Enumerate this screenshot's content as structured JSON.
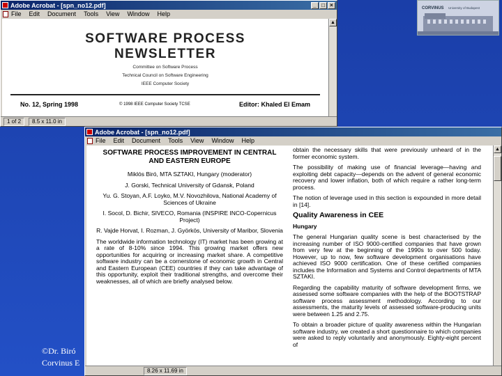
{
  "back_window": {
    "title": "Adobe Acrobat - [spn_no12.pdf]",
    "menu": [
      "File",
      "Edit",
      "Document",
      "Tools",
      "View",
      "Window",
      "Help"
    ],
    "newsletter": {
      "title_line1": "SOFTWARE PROCESS",
      "title_line2": "NEWSLETTER",
      "sub1": "Committee on Software Process",
      "sub2": "Technical Council on Software Engineering",
      "sub3": "IEEE Computer Society",
      "issue": "No. 12, Spring 1998",
      "copyright": "© 1998 IEEE Computer Society TCSE",
      "editor": "Editor: Khaled El Emam"
    },
    "status": {
      "page": "1 of 2",
      "size": "8.5 x 11.0 in"
    }
  },
  "front_window": {
    "title": "Adobe Acrobat - [spn_no12.pdf]",
    "menu": [
      "File",
      "Edit",
      "Document",
      "Tools",
      "View",
      "Window",
      "Help"
    ],
    "left": {
      "heading1": "SOFTWARE PROCESS IMPROVEMENT IN CENTRAL",
      "heading2": "AND EASTERN EUROPE",
      "authors": [
        "Miklós Biró, MTA SZTAKI, Hungary (moderator)",
        "J. Gorski, Technical University of Gdansk, Poland",
        "Yu. G. Stoyan, A.F. Loyko, M.V. Novozhilova, National Academy of Sciences of Ukraine",
        "I. Socol, D. Bichir, SIVECO, Romania (INSPIRE INCO-Copernicus Project)",
        "R. Vajde Horvat, I. Rozman, J. Györkös, University of Maribor, Slovenia"
      ],
      "body": "The worldwide information technology (IT) market has been growing at a rate of 8-10% since 1994. This growing market offers new opportunities for acquiring or increasing market share. A competitive software industry can be a cornerstone of economic growth in Central and Eastern European (CEE) countries if they can take advantage of this opportunity, exploit their traditional strengths, and overcome their weaknesses, all of which are briefly analysed below."
    },
    "right": {
      "p1": "obtain the necessary skills that were previously unheard of in the former economic system.",
      "p2": "The possibility of making use of financial leverage—having and exploiting debt capacity—depends on the advent of general economic recovery and lower inflation, both of which require a rather long-term process.",
      "p3": "The notion of leverage used in this section is expounded in more detail in [14].",
      "section": "Quality Awareness in CEE",
      "subsection": "Hungary",
      "p4": "The general Hungarian quality scene is best characterised by the increasing number of ISO 9000-certified companies that have grown from very few at the beginning of the 1990s to over 500 today. However, up to now, few software development organisations have achieved ISO 9000 certification. One of these certified companies includes the Information and Systems and Control departments of MTA SZTAKI.",
      "p5": "Regarding the capability maturity of software development firms, we assessed some software companies with the help of the BOOTSTRAP software process assessment methodology. According to our assessments, the maturity levels of assessed software-producing units were between 1.25 and 2.75.",
      "p6": "To obtain a broader picture of quality awareness within the Hungarian software industry, we created a short questionnaire to which companies were asked to reply voluntarily and anonymously. Eighty-eight percent of"
    },
    "status": {
      "size": "8.26 x 11.69 in"
    }
  },
  "footer": {
    "line1": "©Dr. Biró",
    "line2": "Corvinus E"
  },
  "colors": {
    "desktop": "#1f48b8",
    "titlebar": "#0a246a",
    "window": "#d4d0c8"
  }
}
